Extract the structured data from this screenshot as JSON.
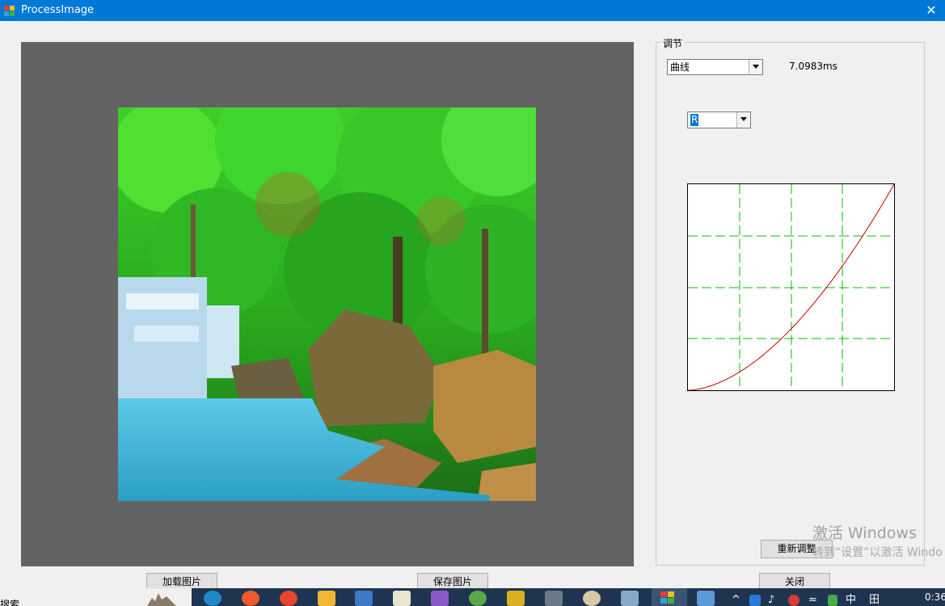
{
  "window": {
    "title": "ProcessImage",
    "close_glyph": "✕"
  },
  "adjust": {
    "group_label": "调节",
    "mode_value": "曲线",
    "elapsed": "7.0983ms",
    "channel_value": "R",
    "reset_button": "重新调整",
    "curve_color": "#c00000",
    "grid_color": "#00c000"
  },
  "buttons": {
    "load": "加载图片",
    "save": "保存图片",
    "close": "关闭"
  },
  "watermark": {
    "line1": "激活 Windows",
    "line2": "转到“设置”以激活 Windo"
  },
  "taskbar": {
    "search_text": "搜索",
    "tray_ime": "中",
    "tray_grid": "田",
    "clock": "0:36"
  }
}
